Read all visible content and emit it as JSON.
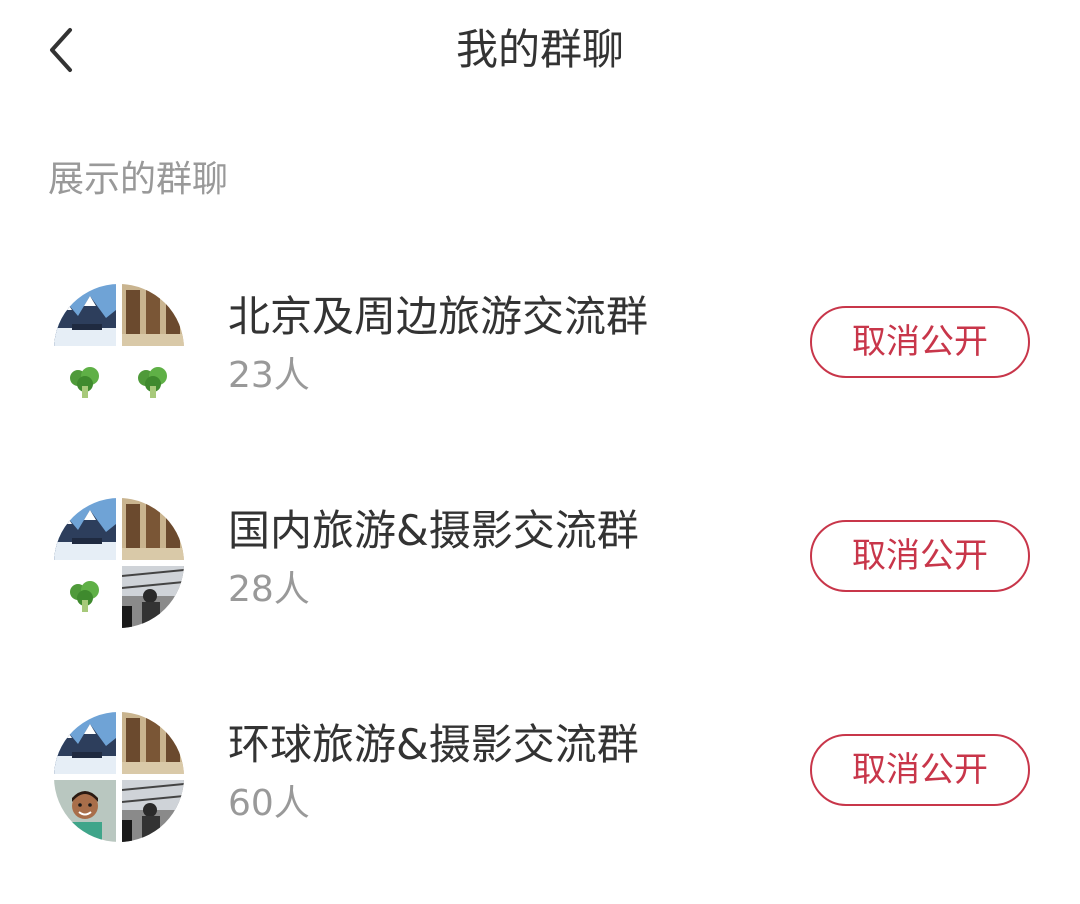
{
  "header": {
    "title": "我的群聊",
    "back_icon": "chevron-left-icon"
  },
  "section": {
    "title": "展示的群聊"
  },
  "groups": [
    {
      "name": "北京及周边旅游交流群",
      "count": "23人",
      "action_label": "取消公开",
      "avatars": [
        "mountain-photo",
        "statues-photo",
        "broccoli-icon",
        "broccoli-icon"
      ]
    },
    {
      "name": "国内旅游&摄影交流群",
      "count": "28人",
      "action_label": "取消公开",
      "avatars": [
        "mountain-photo",
        "statues-photo",
        "broccoli-icon",
        "window-person-photo"
      ]
    },
    {
      "name": "环球旅游&摄影交流群",
      "count": "60人",
      "action_label": "取消公开",
      "avatars": [
        "mountain-photo",
        "statues-photo",
        "child-photo",
        "window-person-photo"
      ]
    }
  ],
  "colors": {
    "accent": "#c8364a",
    "title_text": "#333333",
    "secondary_text": "#999999"
  }
}
